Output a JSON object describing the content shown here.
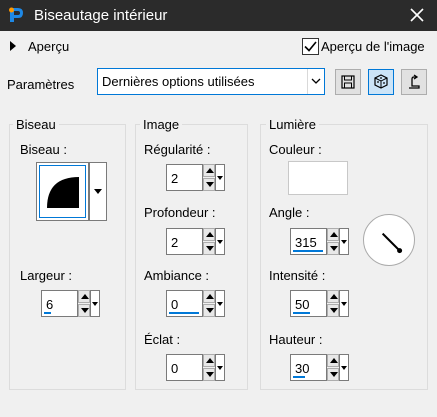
{
  "window": {
    "title": "Biseautage intérieur"
  },
  "apercu": {
    "label": "Aperçu",
    "checkbox_label": "Aperçu de l'image",
    "checked": true
  },
  "parametres": {
    "label": "Paramètres",
    "selected": "Dernières options utilisées"
  },
  "biseau_group": {
    "title": "Biseau",
    "biseau_label": "Biseau :",
    "largeur_label": "Largeur :",
    "largeur_value": "6",
    "largeur_fill": 0.2
  },
  "image_group": {
    "title": "Image",
    "regularite_label": "Régularité :",
    "regularite_value": "2",
    "profondeur_label": "Profondeur :",
    "profondeur_value": "2",
    "ambiance_label": "Ambiance :",
    "ambiance_value": "0",
    "ambiance_fill": 0.9,
    "eclat_label": "Éclat :",
    "eclat_value": "0"
  },
  "lumiere_group": {
    "title": "Lumière",
    "couleur_label": "Couleur :",
    "couleur_value": "#ffffff",
    "angle_label": "Angle :",
    "angle_value": "315",
    "angle_fill": 0.9,
    "intensite_label": "Intensité :",
    "intensite_value": "50",
    "intensite_fill": 0.5,
    "hauteur_label": "Hauteur :",
    "hauteur_value": "30",
    "hauteur_fill": 0.35
  },
  "colors": {
    "accent": "#0078d7",
    "titlebar": "#2b2b2b"
  }
}
